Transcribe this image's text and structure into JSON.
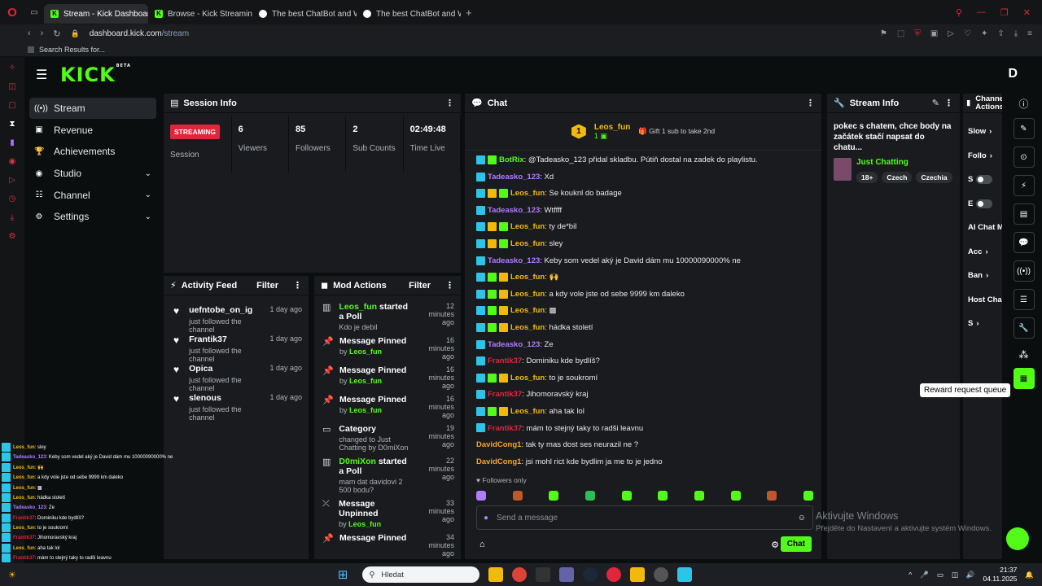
{
  "browser": {
    "tabs": [
      {
        "label": "Stream - Kick Dashboard",
        "active": true,
        "icon": "kick-icon"
      },
      {
        "label": "Browse - Kick Streaming",
        "active": false,
        "icon": "kick-icon"
      },
      {
        "label": "The best ChatBot and Wi",
        "active": false,
        "icon": "chatgpt-icon"
      },
      {
        "label": "The best ChatBot and Wi",
        "active": false,
        "icon": "chatgpt-icon"
      }
    ],
    "url_domain": "dashboard.kick.com",
    "url_path": "/stream",
    "bookmark": "Search Results for...",
    "add_tab": "+"
  },
  "app": {
    "logo": "KICK",
    "beta": "BETA",
    "avatar_letter": "D",
    "accent": "#53fc18",
    "nav": [
      {
        "label": "Stream",
        "icon": "broadcast-icon",
        "active": true,
        "chevron": false
      },
      {
        "label": "Revenue",
        "icon": "revenue-icon",
        "active": false,
        "chevron": false
      },
      {
        "label": "Achievements",
        "icon": "trophy-icon",
        "active": false,
        "chevron": false
      },
      {
        "label": "Studio",
        "icon": "studio-icon",
        "active": false,
        "chevron": true
      },
      {
        "label": "Channel",
        "icon": "channel-icon",
        "active": false,
        "chevron": true
      },
      {
        "label": "Settings",
        "icon": "gear-icon",
        "active": false,
        "chevron": true
      }
    ]
  },
  "session": {
    "title": "Session Info",
    "badge": "STREAMING",
    "badge_label": "Session",
    "stats": [
      {
        "value": "6",
        "label": "Viewers"
      },
      {
        "value": "85",
        "label": "Followers"
      },
      {
        "value": "2",
        "label": "Sub Counts"
      },
      {
        "value": "02:49:48",
        "label": "Time Live"
      }
    ]
  },
  "activity": {
    "title": "Activity Feed",
    "filter": "Filter",
    "items": [
      {
        "name": "uefntobe_on_ig",
        "sub": "just followed the channel",
        "time": "1 day ago"
      },
      {
        "name": "Frantik37",
        "sub": "just followed the channel",
        "time": "1 day ago"
      },
      {
        "name": "Opica",
        "sub": "just followed the channel",
        "time": "1 day ago"
      },
      {
        "name": "slenous",
        "sub": "just followed the channel",
        "time": "1 day ago"
      }
    ]
  },
  "mod": {
    "title": "Mod Actions",
    "filter": "Filter",
    "items": [
      {
        "icon": "poll-icon",
        "pre": "",
        "user": "Leos_fun",
        "post": " started a Poll",
        "sub": "Kdo je debil",
        "by": "",
        "time": "12 minutes ago"
      },
      {
        "icon": "pin-icon",
        "pre": "Message Pinned",
        "user": "",
        "post": "",
        "sub": "by ",
        "by": "Leos_fun",
        "time": "16 minutes ago"
      },
      {
        "icon": "pin-icon",
        "pre": "Message Pinned",
        "user": "",
        "post": "",
        "sub": "by ",
        "by": "Leos_fun",
        "time": "16 minutes ago"
      },
      {
        "icon": "pin-icon",
        "pre": "Message Pinned",
        "user": "",
        "post": "",
        "sub": "by ",
        "by": "Leos_fun",
        "time": "16 minutes ago"
      },
      {
        "icon": "category-icon",
        "pre": "Category",
        "user": "",
        "post": "",
        "sub": "changed to Just Chatting by D0miXon",
        "by": "",
        "time": "19 minutes ago"
      },
      {
        "icon": "poll-icon",
        "pre": "",
        "user": "D0miXon",
        "post": " started a Poll",
        "sub": "mam dat davidovi 2 500 bodu?",
        "by": "",
        "time": "22 minutes ago"
      },
      {
        "icon": "unpin-icon",
        "pre": "Message Unpinned",
        "user": "",
        "post": "",
        "sub": "by ",
        "by": "Leos_fun",
        "time": "33 minutes ago"
      },
      {
        "icon": "pin-icon",
        "pre": "Message Pinned",
        "user": "",
        "post": "",
        "sub": "",
        "by": "",
        "time": "34 minutes ago"
      }
    ]
  },
  "chat": {
    "title": "Chat",
    "pinned_user": "Leos_fun",
    "pinned_level": "1",
    "pinned_count": "1",
    "gift_text": "Gift 1 sub to take 2nd",
    "messages": [
      {
        "badges": "bs",
        "user": "BotRix",
        "color": "#53fc18",
        "text": ": @Tadeasko_123 přidal skladbu. Pútiň dostal na zadek do playlistu."
      },
      {
        "badges": "b",
        "user": "Tadeasko_123",
        "color": "#b07cff",
        "text": ": Xd"
      },
      {
        "badges": "bgs",
        "user": "Leos_fun",
        "color": "#f2b90d",
        "text": ": Se kouknl do badage"
      },
      {
        "badges": "b",
        "user": "Tadeasko_123",
        "color": "#b07cff",
        "text": ": Wtffff"
      },
      {
        "badges": "bgs",
        "user": "Leos_fun",
        "color": "#f2b90d",
        "text": ": ty de*bil"
      },
      {
        "badges": "bgs",
        "user": "Leos_fun",
        "color": "#f2b90d",
        "text": ": sley"
      },
      {
        "badges": "b",
        "user": "Tadeasko_123",
        "color": "#b07cff",
        "text": ": Keby som vedel aký je David dám mu 10000090000% ne"
      },
      {
        "badges": "bsg",
        "user": "Leos_fun",
        "color": "#f2b90d",
        "text": ": 🙌"
      },
      {
        "badges": "bsg",
        "user": "Leos_fun",
        "color": "#f2b90d",
        "text": ": a kdy vole jste od sebe 9999 km daleko"
      },
      {
        "badges": "bsg",
        "user": "Leos_fun",
        "color": "#f2b90d",
        "text": ": ▩"
      },
      {
        "badges": "bsg",
        "user": "Leos_fun",
        "color": "#f2b90d",
        "text": ": hádka století"
      },
      {
        "badges": "b",
        "user": "Tadeasko_123",
        "color": "#b07cff",
        "text": ": Ze"
      },
      {
        "badges": "b",
        "user": "Frantik37",
        "color": "#e0263b",
        "text": ": Dominiku kde bydlíš?"
      },
      {
        "badges": "bsg",
        "user": "Leos_fun",
        "color": "#f2b90d",
        "text": ": to je soukromí"
      },
      {
        "badges": "b",
        "user": "Frantik37",
        "color": "#e0263b",
        "text": ": Jihomoravský kraj"
      },
      {
        "badges": "bsg",
        "user": "Leos_fun",
        "color": "#f2b90d",
        "text": ": aha tak lol"
      },
      {
        "badges": "b",
        "user": "Frantik37",
        "color": "#e0263b",
        "text": ": mám to stejný taky to radši leavnu"
      },
      {
        "badges": "",
        "user": "DavidCong1",
        "color": "#f5a623",
        "text": ": tak ty mas dost ses neurazil ne ?"
      },
      {
        "badges": "",
        "user": "DavidCong1",
        "color": "#f5a623",
        "text": ": jsi mohl rict kde bydlim ja me to je jedno"
      }
    ],
    "followers_only": "Followers only",
    "placeholder": "Send a message",
    "send_label": "Chat"
  },
  "streaminfo": {
    "title": "Stream Info",
    "stream_title": "pokec s chatem, chce body na začátek stačí napsat do chatu...",
    "category": "Just Chatting",
    "tags": [
      "18+",
      "Czech",
      "Czechia"
    ]
  },
  "actions": {
    "title": "Channel Actions",
    "rows": [
      "Slow",
      "Follo",
      "S",
      "E",
      "AI Chat Moderation",
      "Acc",
      "Ban",
      "Host Cha",
      "S"
    ]
  },
  "tooltip": "Reward request queue",
  "windows_watermark": {
    "line1": "Aktivujte Windows",
    "line2": "Přejděte do Nastavení a aktivujte systém Windows."
  },
  "overlay": [
    {
      "user": "Leos_fun",
      "color": "#f2b90d",
      "text": ": sley"
    },
    {
      "user": "Tadeasko_123",
      "color": "#b07cff",
      "text": ": Keby som vedel aký je David dám mu 10000090000% ne"
    },
    {
      "user": "Leos_fun",
      "color": "#f2b90d",
      "text": ": 🙌"
    },
    {
      "user": "Leos_fun",
      "color": "#f2b90d",
      "text": ": a kdy vole jste od sebe 9999 km daleko"
    },
    {
      "user": "Leos_fun",
      "color": "#f2b90d",
      "text": ": ▩"
    },
    {
      "user": "Leos_fun",
      "color": "#f2b90d",
      "text": ": hádka století"
    },
    {
      "user": "Tadeasko_123",
      "color": "#b07cff",
      "text": ": Ze"
    },
    {
      "user": "Frantik37",
      "color": "#e0263b",
      "text": ": Dominiku kde bydlíš?"
    },
    {
      "user": "Leos_fun",
      "color": "#f2b90d",
      "text": ": to je soukromí"
    },
    {
      "user": "Frantik37",
      "color": "#e0263b",
      "text": ": Jihomoravský kraj"
    },
    {
      "user": "Leos_fun",
      "color": "#f2b90d",
      "text": ": aha tak lol"
    },
    {
      "user": "Frantik37",
      "color": "#e0263b",
      "text": ": mám to stejný taky to radši leavnu"
    },
    {
      "user": "DavidCong1",
      "color": "#f5a623",
      "text": ": tak ty mas dost ses neurazil ne ?"
    },
    {
      "user": "DavidCong1",
      "color": "#f5a623",
      "text": ": jsi mohl rict kde bydlim ja me to je jedno"
    }
  ],
  "taskbar": {
    "search_placeholder": "Hledat",
    "time": "21:37",
    "date": "04.11.2025"
  }
}
